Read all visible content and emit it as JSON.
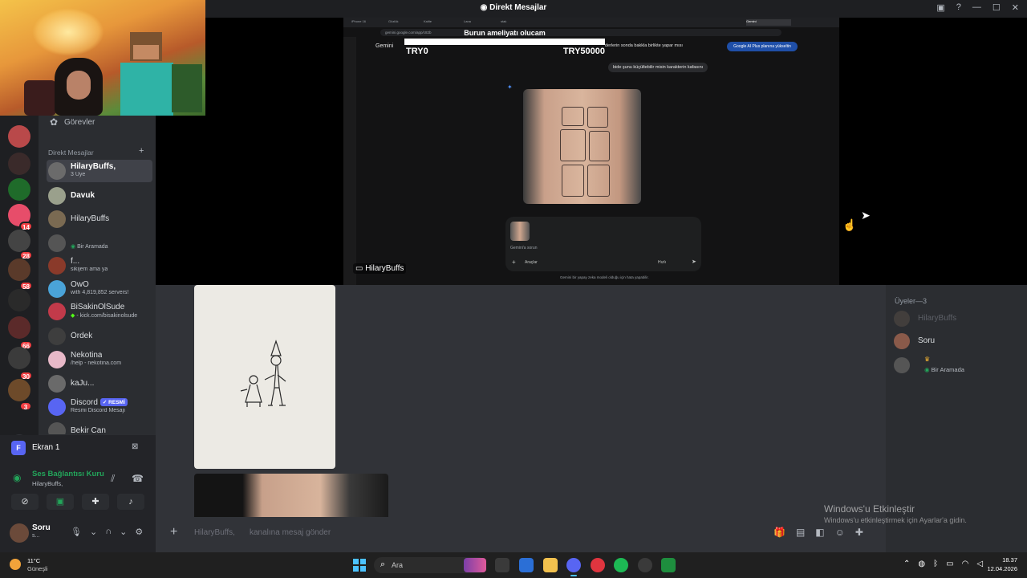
{
  "window": {
    "title": "Direkt Mesajlar"
  },
  "webcam": {},
  "dm_sidebar": {
    "tasks_label": "Görevler",
    "section_title": "Direkt Mesajlar",
    "section_add": "+",
    "items": [
      {
        "name": "HilaryBuffs,",
        "sub": "3 Üye",
        "active": true
      },
      {
        "name": "Davuk",
        "sub": ""
      },
      {
        "name": "HilaryBuffs",
        "sub": ""
      },
      {
        "name": "",
        "sub": "Bir Aramada"
      },
      {
        "name": "f...",
        "sub": "sikijem ama ya"
      },
      {
        "name": "OwO",
        "sub": "with 4,819,852 servers!"
      },
      {
        "name": "BiSakinOlSude",
        "sub": "- kick.com/bisakinolsude"
      },
      {
        "name": "Ördek",
        "sub": ""
      },
      {
        "name": "Nekotina",
        "sub": "/help - nekotina.com"
      },
      {
        "name": "kaJu...",
        "sub": ""
      },
      {
        "name": "Discord",
        "sub": "Resmi Discord Mesajı",
        "badge": "✓ RESMİ"
      },
      {
        "name": "Bekir Can",
        "sub": ""
      }
    ]
  },
  "server_badges": [
    "14",
    "28",
    "58",
    "66",
    "30",
    "3"
  ],
  "voice_panel": {
    "screen_avatar": "F",
    "screen_label": "Ekran 1",
    "connection_title": "Ses Bağlantısı Kuru",
    "connection_sub": "HilaryBuffs,",
    "user_name": "Soru",
    "user_status": "s..."
  },
  "stream": {
    "streamer_name": "HilaryBuffs",
    "browser_url": "gemini.google.com/app/c82b",
    "gemini_label": "Gemini",
    "donation_title": "Burun ameliyatı olucam",
    "donation_min": "TRY0",
    "donation_max": "TRY50000",
    "donation_progress": 0.0,
    "chat_top_text": "derlerin sonda bakkla birlikte yapar mısı",
    "upgrade_label": "Google AI Plus planına yükseltin",
    "user_bubble": "bide şunu küçültebilir misin karakterin kafasını",
    "composer_hint": "Gemini'a sorun",
    "tools_label": "Araçlar",
    "model_label": "Hızlı",
    "disclaimer": "Gemini bir yapay zeka modeli olduğu için hata yapabilir."
  },
  "chat": {
    "input_placeholder_channel": "HilaryBuffs,",
    "input_placeholder_text": "kanalına mesaj gönder"
  },
  "members": {
    "header": "Üyeler—3",
    "list": [
      {
        "name": "HilaryBuffs",
        "sub": "",
        "dim": true
      },
      {
        "name": "Soru",
        "sub": ""
      },
      {
        "name": "",
        "sub": "Bir Aramada"
      }
    ]
  },
  "watermark": {
    "title": "Windows'u Etkinleştir",
    "sub": "Windows'u etkinleştirmek için Ayarlar'a gidin."
  },
  "taskbar": {
    "weather_temp": "11°C",
    "weather_cond": "Güneşli",
    "search_label": "Ara",
    "time": "18.37",
    "date": "12.04.2026"
  },
  "colors": {
    "discord_bg": "#313338",
    "sidebar_bg": "#2b2d31",
    "rail_bg": "#1e1f22",
    "blurple": "#5865f2",
    "green": "#23a55a",
    "red_badge": "#f23f43"
  }
}
